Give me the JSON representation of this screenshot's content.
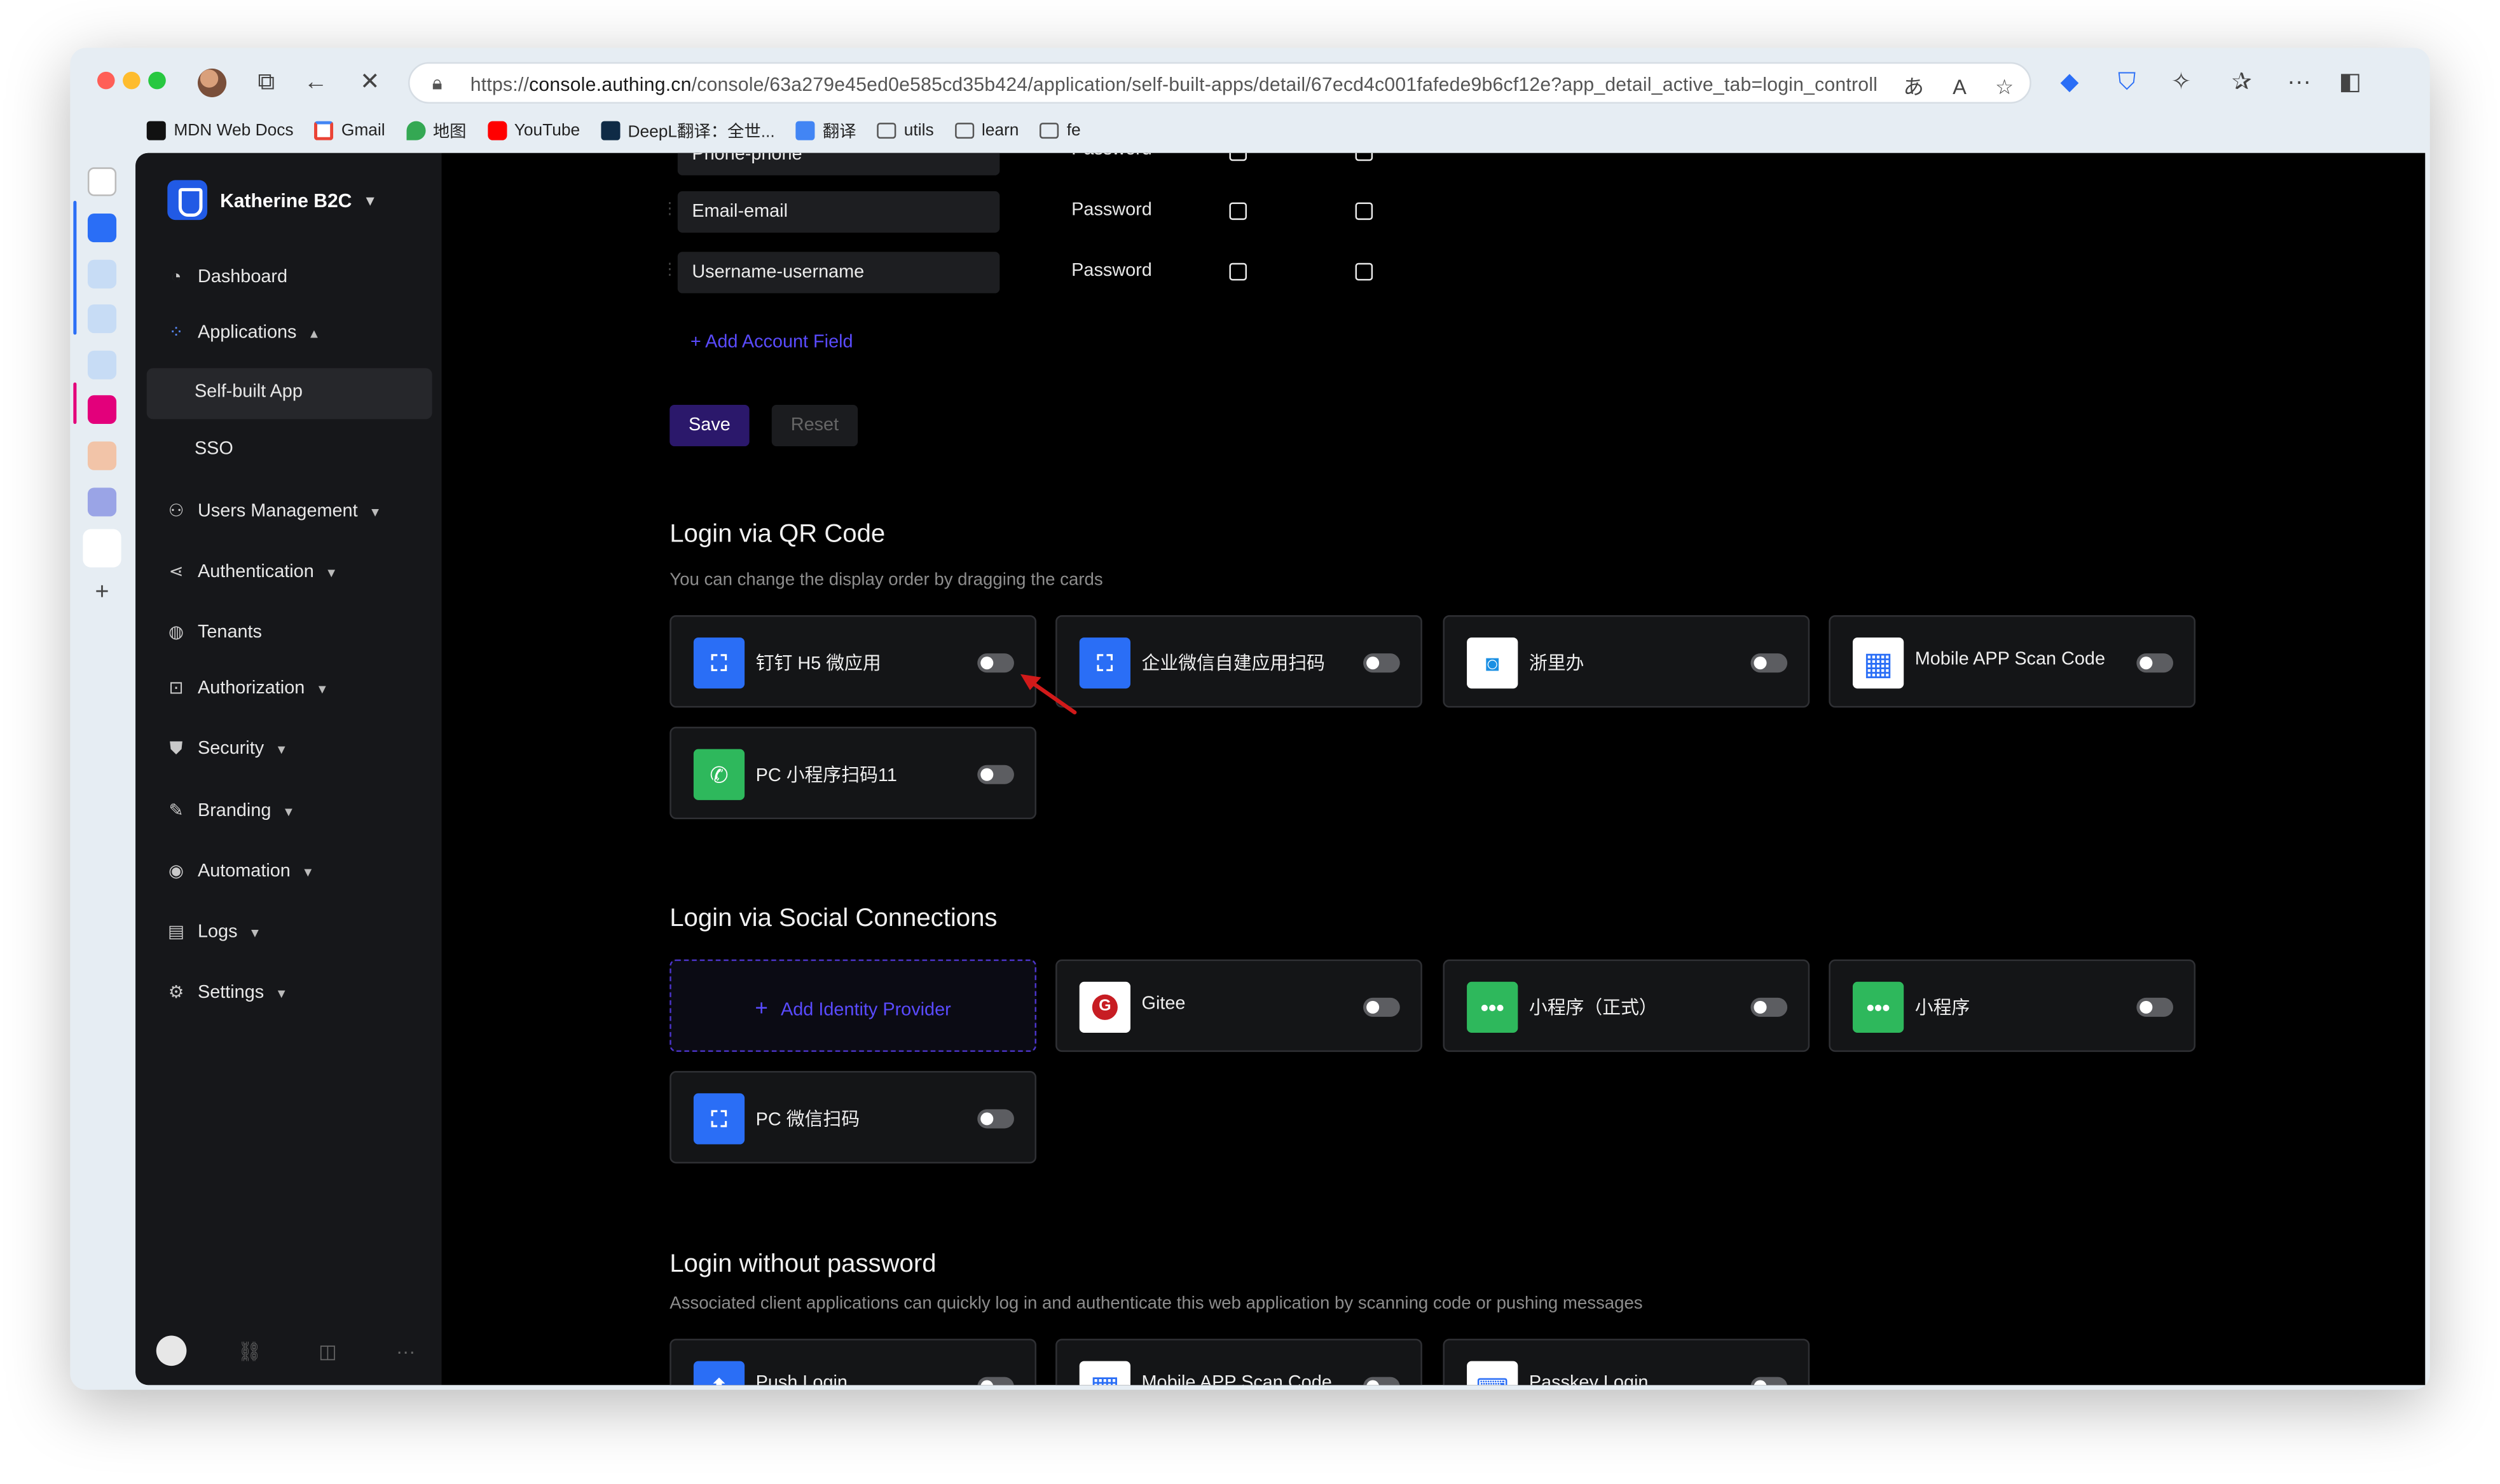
{
  "browser": {
    "url_prefix": "https://",
    "url_host": "console.authing.cn",
    "url_path": "/console/63a279e45ed0e585cd35b424/application/self-built-apps/detail/67ecd4c001fafede9b6cf12e?app_detail_active_tab=login_controll"
  },
  "bookmarks": [
    {
      "label": "MDN Web Docs",
      "icon": "mdn-icon",
      "color": "#111111"
    },
    {
      "label": "Gmail",
      "icon": "gmail-icon",
      "color": "#ea4335"
    },
    {
      "label": "地图",
      "icon": "maps-icon",
      "color": "#34a853"
    },
    {
      "label": "YouTube",
      "icon": "youtube-icon",
      "color": "#ff0000"
    },
    {
      "label": "DeepL翻译：全世...",
      "icon": "deepl-icon",
      "color": "#0f2b46"
    },
    {
      "label": "翻译",
      "icon": "translate-icon",
      "color": "#4285f4"
    },
    {
      "label": "utils",
      "icon": "folder-icon"
    },
    {
      "label": "learn",
      "icon": "folder-icon"
    },
    {
      "label": "fe",
      "icon": "folder-icon"
    }
  ],
  "sidebar": {
    "brand": "Katherine B2C",
    "items": [
      {
        "label": "Dashboard",
        "icon": "dashboard-icon"
      },
      {
        "label": "Applications",
        "icon": "applications-icon"
      },
      {
        "label": "Users Management",
        "icon": "users-icon"
      },
      {
        "label": "Authentication",
        "icon": "authentication-icon"
      },
      {
        "label": "Tenants",
        "icon": "tenants-icon"
      },
      {
        "label": "Authorization",
        "icon": "authorization-icon"
      },
      {
        "label": "Security",
        "icon": "security-icon"
      },
      {
        "label": "Branding",
        "icon": "branding-icon"
      },
      {
        "label": "Automation",
        "icon": "automation-icon"
      },
      {
        "label": "Logs",
        "icon": "logs-icon"
      },
      {
        "label": "Settings",
        "icon": "settings-icon"
      }
    ],
    "sub_items": [
      "Self-built App",
      "SSO"
    ]
  },
  "account_fields": [
    {
      "field": "Phone-phone",
      "type": "Password"
    },
    {
      "field": "Email-email",
      "type": "Password"
    },
    {
      "field": "Username-username",
      "type": "Password"
    }
  ],
  "add_account_field": "+ Add Account Field",
  "actions": {
    "save": "Save",
    "reset": "Reset"
  },
  "qr_section": {
    "title": "Login via QR Code",
    "desc": "You can change the display order by dragging the cards",
    "cards": [
      {
        "label": "钉钉 H5 微应用",
        "icon": "scan-icon",
        "color": "#2a6ef6"
      },
      {
        "label": "企业微信自建应用扫码",
        "icon": "scan-icon",
        "color": "#2a6ef6"
      },
      {
        "label": "浙里办",
        "icon": "zheliban-icon",
        "color": "#ffffff"
      },
      {
        "label": "Mobile APP Scan Code",
        "icon": "qr-grid-icon",
        "color": "#ffffff"
      },
      {
        "label": "PC 小程序扫码11",
        "icon": "miniprogram-icon",
        "color": "#2eb85c"
      }
    ]
  },
  "social_section": {
    "title": "Login via Social Connections",
    "add_label": "Add Identity Provider",
    "cards": [
      {
        "label": "Gitee",
        "icon": "gitee-icon",
        "color": "#ffffff"
      },
      {
        "label": "小程序（正式）",
        "icon": "miniprogram-dots-icon",
        "color": "#2eb85c"
      },
      {
        "label": "小程序",
        "icon": "miniprogram-dots-icon",
        "color": "#2eb85c"
      },
      {
        "label": "PC 微信扫码",
        "icon": "scan-icon",
        "color": "#2a6ef6"
      }
    ]
  },
  "passwordless_section": {
    "title": "Login without password",
    "desc": "Associated client applications can quickly log in and authenticate this web application by scanning code or pushing messages",
    "cards": [
      {
        "label": "Push Login",
        "icon": "push-icon",
        "color": "#2a6ef6"
      },
      {
        "label": "Mobile APP Scan Code",
        "icon": "qr-grid-icon",
        "color": "#ffffff"
      },
      {
        "label": "Passkey Login",
        "icon": "passkey-icon",
        "color": "#ffffff"
      }
    ]
  },
  "colors": {
    "accent": "#5a4bff",
    "save_button": "#2b186b",
    "brand": "#215ae5"
  }
}
